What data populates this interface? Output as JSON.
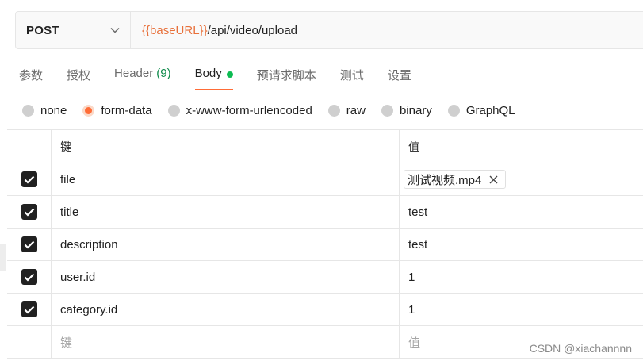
{
  "request": {
    "method": "POST",
    "url_var": "{{baseURL}}",
    "url_path": "/api/video/upload"
  },
  "tabs": [
    {
      "label": "参数"
    },
    {
      "label": "授权"
    },
    {
      "label": "Header",
      "count": "(9)"
    },
    {
      "label": "Body"
    },
    {
      "label": "预请求脚本"
    },
    {
      "label": "测试"
    },
    {
      "label": "设置"
    }
  ],
  "body_types": [
    "none",
    "form-data",
    "x-www-form-urlencoded",
    "raw",
    "binary",
    "GraphQL"
  ],
  "body_type_selected": "form-data",
  "table": {
    "headers": {
      "key": "键",
      "value": "值"
    },
    "rows": [
      {
        "key": "file",
        "value": "测试视频.mp4",
        "type": "file",
        "checked": true
      },
      {
        "key": "title",
        "value": "test",
        "checked": true
      },
      {
        "key": "description",
        "value": "test",
        "checked": true
      },
      {
        "key": "user.id",
        "value": "1",
        "checked": true
      },
      {
        "key": "category.id",
        "value": "1",
        "checked": true
      }
    ],
    "placeholder": {
      "key": "键",
      "value": "值"
    }
  },
  "watermark": "CSDN @xiachannnn",
  "colors": {
    "accent": "#ff6c37",
    "url_var": "#e8703a",
    "body_dot": "#0cbb52",
    "header_count": "#0e8a4a"
  }
}
